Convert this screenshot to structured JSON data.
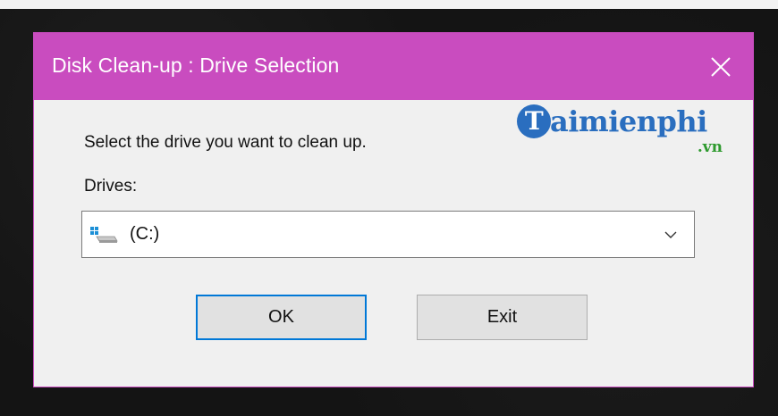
{
  "window": {
    "title": "Disk Clean-up : Drive Selection",
    "accent_color": "#c94cbf"
  },
  "watermark": {
    "brand_main": "aimienphi",
    "brand_initial": "T",
    "brand_suffix": ".vn"
  },
  "content": {
    "prompt": "Select the drive you want to clean up.",
    "drives_label": "Drives:",
    "selected_drive": "(C:)",
    "drive_icon": "windows-drive-icon"
  },
  "buttons": {
    "ok_label": "OK",
    "exit_label": "Exit"
  }
}
